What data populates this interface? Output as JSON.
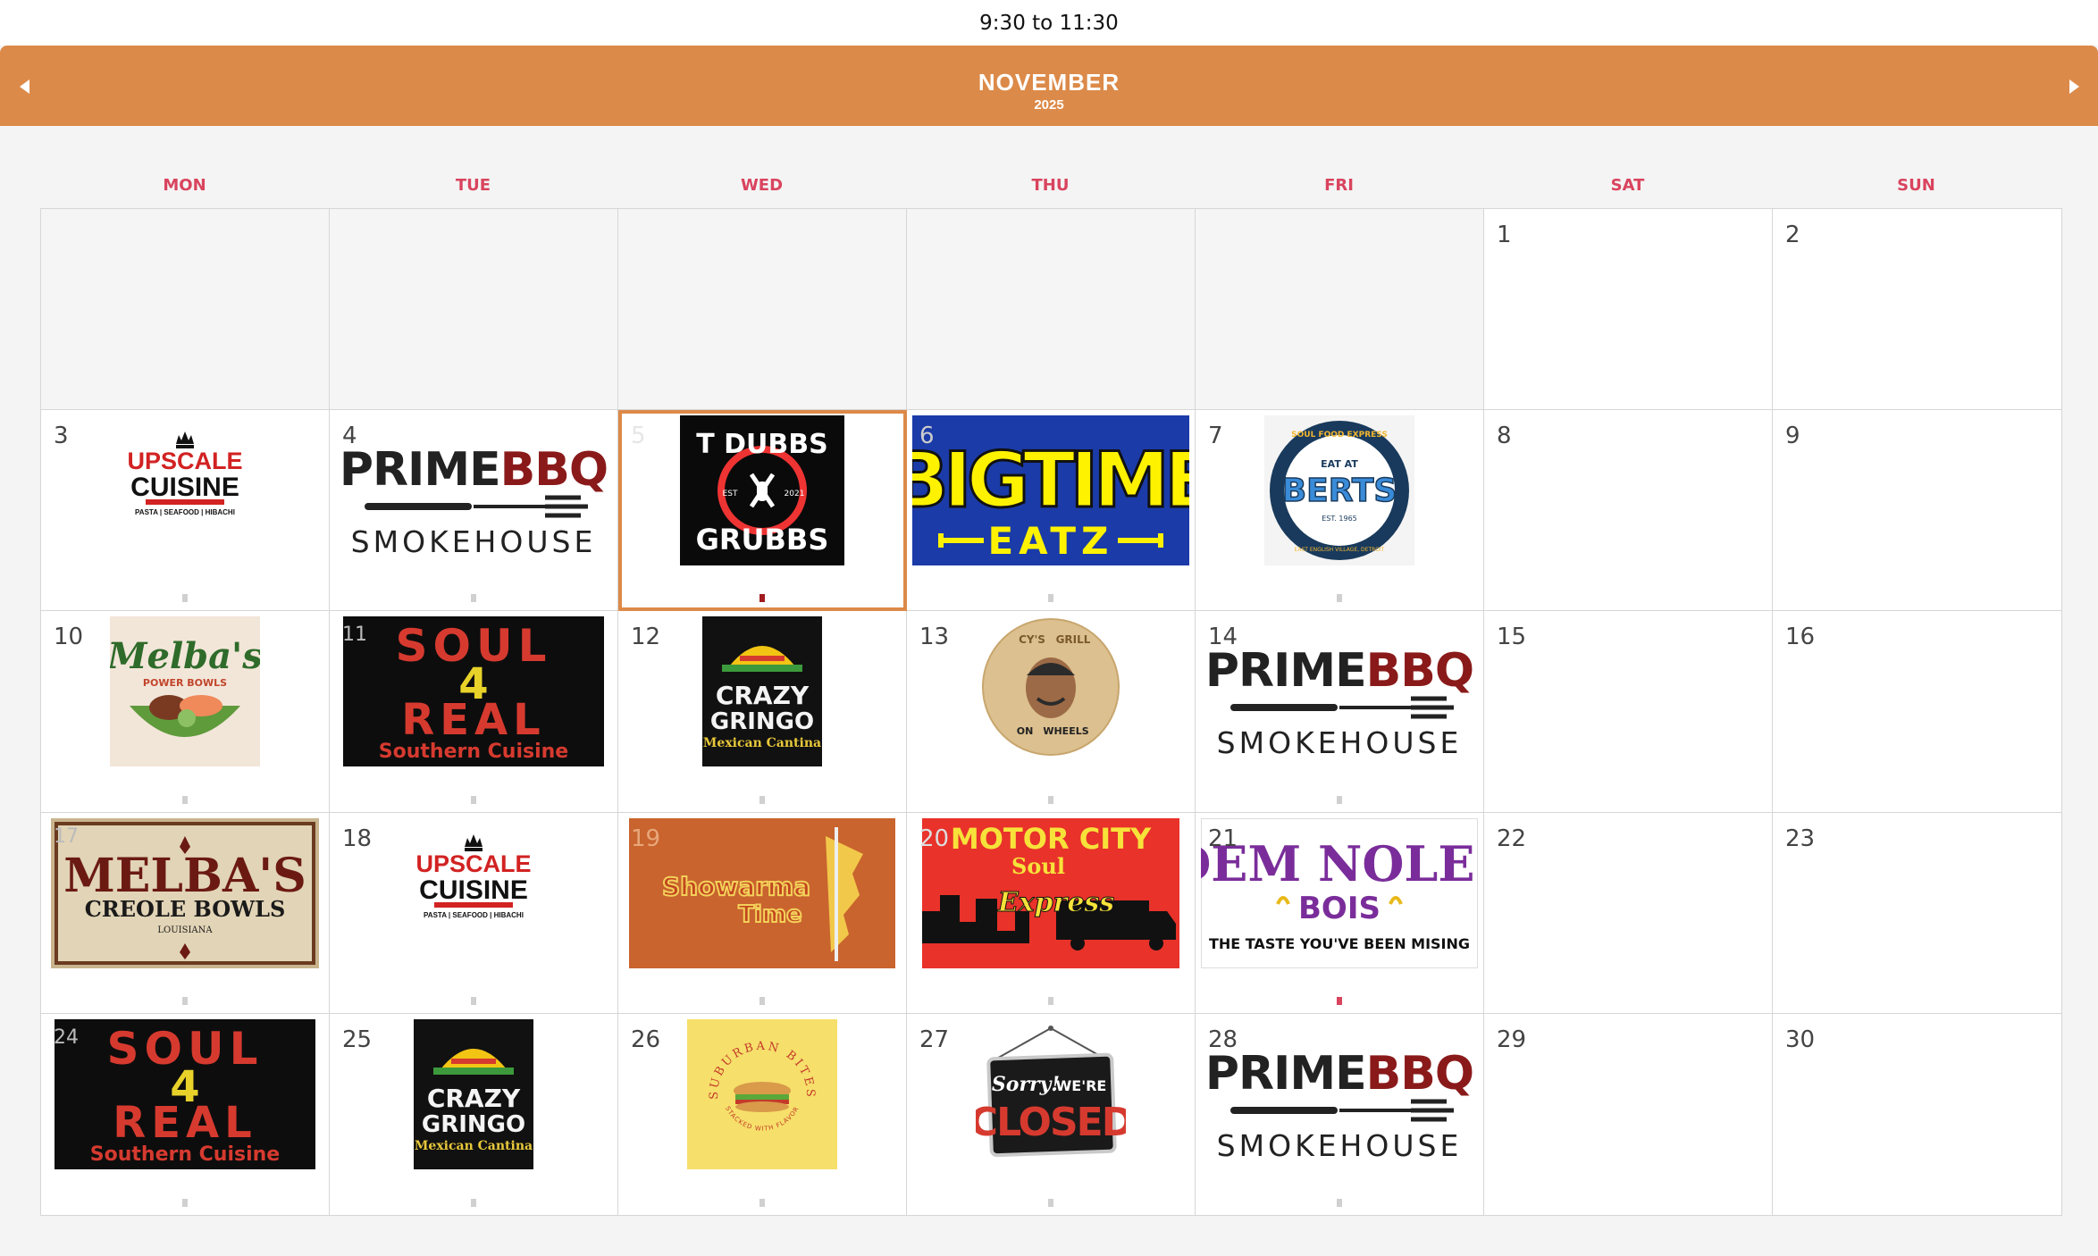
{
  "time_range": "9:30 to 11:30",
  "calendar": {
    "month": "NOVEMBER",
    "year": "2025",
    "weekdays": [
      "MON",
      "TUE",
      "WED",
      "THU",
      "FRI",
      "SAT",
      "SUN"
    ]
  },
  "colors": {
    "accent": "#dc8a49",
    "weekday": "#d9445e",
    "today_border": "#dc8a49"
  },
  "days": {
    "d1": "1",
    "d2": "2",
    "d3": "3",
    "d4": "4",
    "d5": "5",
    "d6": "6",
    "d7": "7",
    "d8": "8",
    "d9": "9",
    "d10": "10",
    "d11": "11",
    "d12": "12",
    "d13": "13",
    "d14": "14",
    "d15": "15",
    "d16": "16",
    "d17": "17",
    "d18": "18",
    "d19": "19",
    "d20": "20",
    "d21": "21",
    "d22": "22",
    "d23": "23",
    "d24": "24",
    "d25": "25",
    "d26": "26",
    "d27": "27",
    "d28": "28",
    "d29": "29",
    "d30": "30"
  },
  "vendors": {
    "upscale": {
      "name": "UPSCALE",
      "name2": "CUISINE",
      "tagline": "PASTA | SEAFOOD | HIBACHI"
    },
    "prime": {
      "name_a": "PRIME",
      "name_b": "BBQ",
      "tagline": "SMOKEHOUSE"
    },
    "tdubbs": {
      "name": "T DUBBS",
      "name2": "GRUBBS",
      "est": "EST",
      "year": "2021"
    },
    "bigtime": {
      "name": "BIGTIME",
      "name2": "EATZ"
    },
    "berts": {
      "ring_top": "SOUL FOOD EXPRESS",
      "eat_at": "EAT AT",
      "name": "BERTS",
      "est": "EST. 1965",
      "ring_bottom": "EAST ENGLISH VILLAGE, DETROIT"
    },
    "melba_power": {
      "name": "Melba's",
      "sub": "POWER BOWLS"
    },
    "soul4real": {
      "line1": "SOUL",
      "line2": "4",
      "line3": "REAL",
      "tagline": "Southern Cuisine"
    },
    "crazy_gringo": {
      "line1": "CRAZY",
      "line2": "GRINGO",
      "tagline": "Mexican Cantina"
    },
    "cys_grill": {
      "name": "CY'S",
      "name2": "GRILL",
      "on": "ON",
      "wheels": "WHEELS"
    },
    "melba_creole": {
      "name": "MELBA'S",
      "sub": "CREOLE BOWLS",
      "state": "LOUISIANA"
    },
    "showarma": {
      "name": "Showarma",
      "name2": "Time"
    },
    "motor_city": {
      "line1": "MOTOR CITY",
      "line2": "Soul",
      "line3": "Express"
    },
    "dem_noles": {
      "line1": "DEM NOLES",
      "line2": "BOIS",
      "tagline": "THE TASTE YOU'VE BEEN MISING"
    },
    "suburban": {
      "ring": "SUBURBAN BITES",
      "ring2": "STACKED WITH FLAVOR"
    },
    "closed": {
      "sorry": "Sorry!",
      "were": "WE'RE",
      "closed": "CLOSED"
    }
  }
}
